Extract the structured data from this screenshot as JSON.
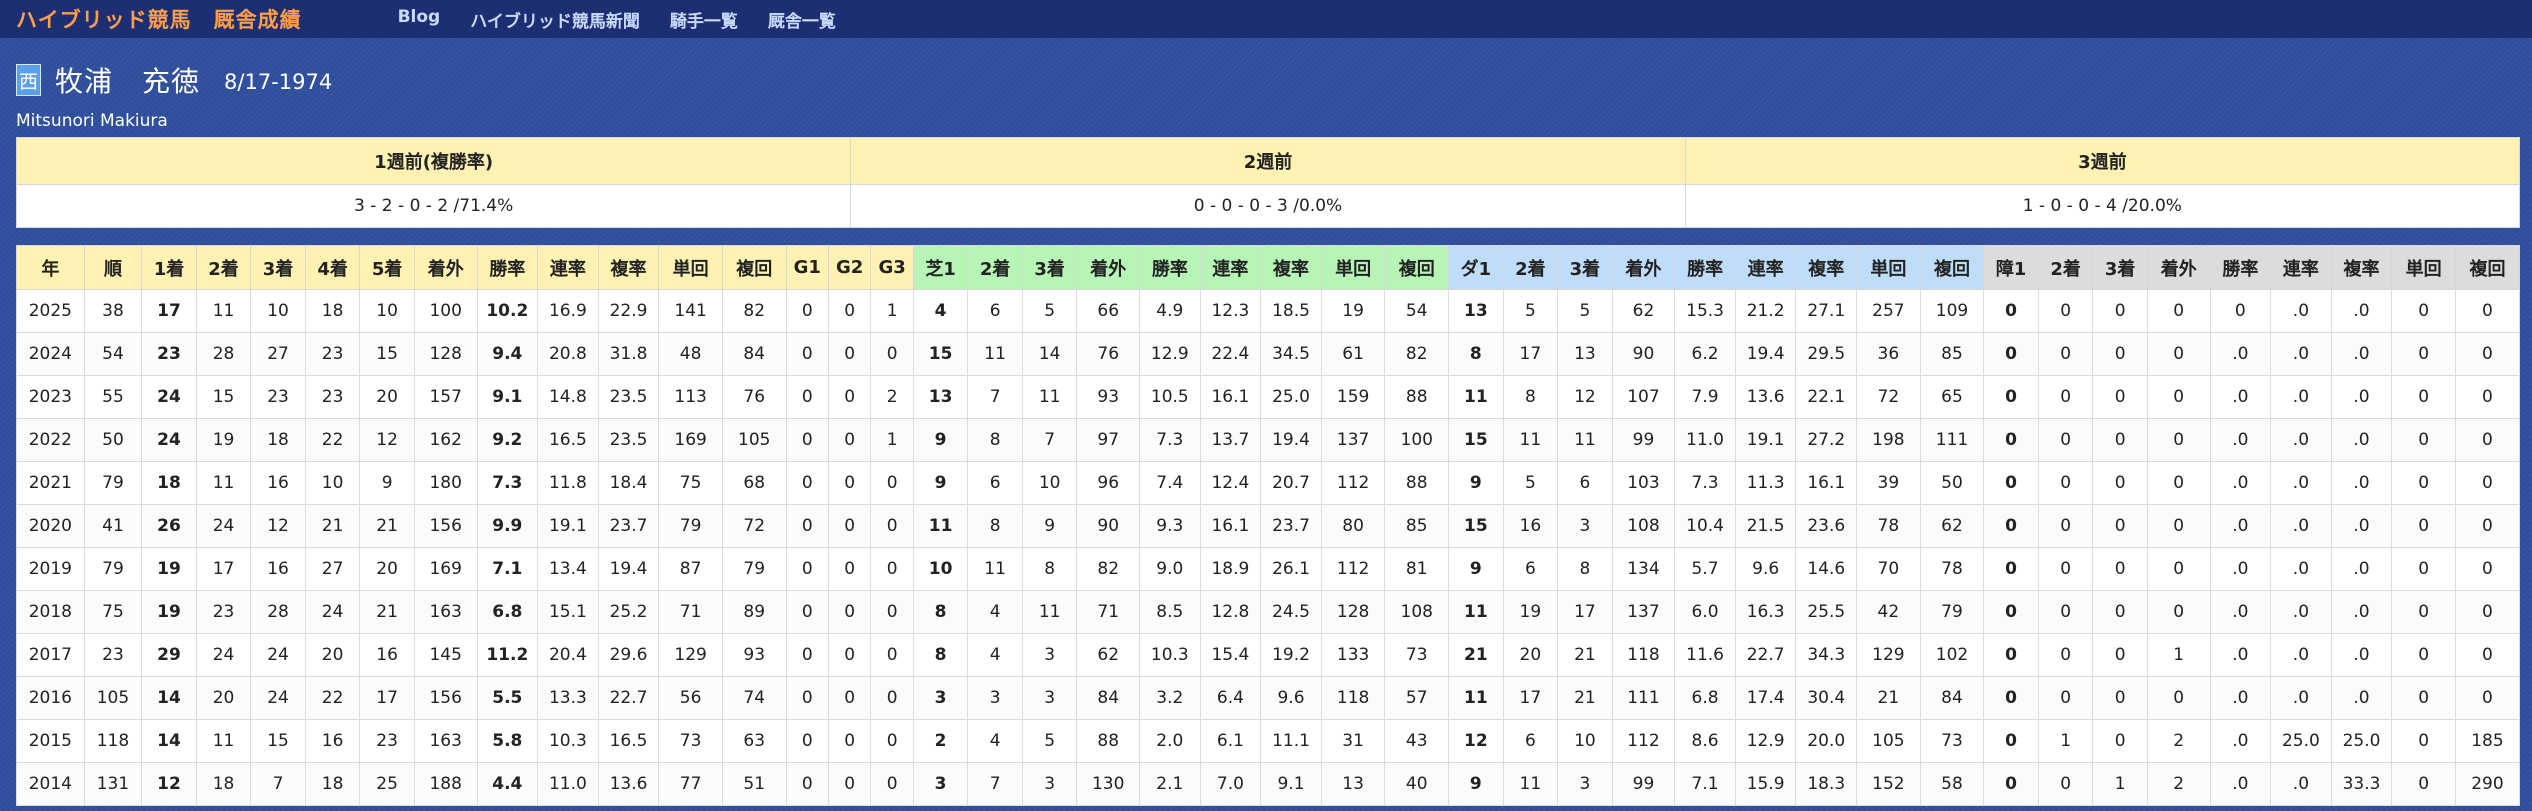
{
  "nav": {
    "brand": "ハイブリッド競馬",
    "section": "厩舎成績",
    "links": [
      "Blog",
      "ハイブリッド競馬新聞",
      "騎手一覧",
      "厩舎一覧"
    ]
  },
  "jockey": {
    "region_badge": "西",
    "name": "牧浦　充徳",
    "birthdate": "8/17-1974",
    "romaji": "Mitsunori Makiura"
  },
  "weeks": {
    "headers": [
      "1週前(複勝率)",
      "2週前",
      "3週前"
    ],
    "values": [
      "3 - 2 - 0 - 2 /71.4%",
      "0 - 0 - 0 - 3 /0.0%",
      "1 - 0 - 0 - 4 /20.0%"
    ]
  },
  "stats": {
    "headers": [
      "年",
      "順",
      "1着",
      "2着",
      "3着",
      "4着",
      "5着",
      "着外",
      "勝率",
      "連率",
      "複率",
      "単回",
      "複回",
      "G1",
      "G2",
      "G3",
      "芝1",
      "2着",
      "3着",
      "着外",
      "勝率",
      "連率",
      "複率",
      "単回",
      "複回",
      "ダ1",
      "2着",
      "3着",
      "着外",
      "勝率",
      "連率",
      "複率",
      "単回",
      "複回",
      "障1",
      "2着",
      "3着",
      "着外",
      "勝率",
      "連率",
      "複率",
      "単回",
      "複回"
    ],
    "header_groups": [
      "main",
      "main",
      "main",
      "main",
      "main",
      "main",
      "main",
      "main",
      "main",
      "main",
      "main",
      "main",
      "main",
      "main",
      "main",
      "main",
      "turf",
      "turf",
      "turf",
      "turf",
      "turf",
      "turf",
      "turf",
      "turf",
      "turf",
      "dirt",
      "dirt",
      "dirt",
      "dirt",
      "dirt",
      "dirt",
      "dirt",
      "dirt",
      "dirt",
      "steep",
      "steep",
      "steep",
      "steep",
      "steep",
      "steep",
      "steep",
      "steep",
      "steep"
    ],
    "bold_columns": [
      2,
      8,
      16,
      25,
      34
    ],
    "group_colors": {
      "main": "#fff2b3",
      "turf": "#b7f5b7",
      "dirt": "#bfdcf8",
      "steep": "#dcdcdc"
    },
    "rows": [
      [
        "2025",
        "38",
        "17",
        "11",
        "10",
        "18",
        "10",
        "100",
        "10.2",
        "16.9",
        "22.9",
        "141",
        "82",
        "0",
        "0",
        "1",
        "4",
        "6",
        "5",
        "66",
        "4.9",
        "12.3",
        "18.5",
        "19",
        "54",
        "13",
        "5",
        "5",
        "62",
        "15.3",
        "21.2",
        "27.1",
        "257",
        "109",
        "0",
        "0",
        "0",
        "0",
        "0",
        ".0",
        ".0",
        "0",
        "0"
      ],
      [
        "2024",
        "54",
        "23",
        "28",
        "27",
        "23",
        "15",
        "128",
        "9.4",
        "20.8",
        "31.8",
        "48",
        "84",
        "0",
        "0",
        "0",
        "15",
        "11",
        "14",
        "76",
        "12.9",
        "22.4",
        "34.5",
        "61",
        "82",
        "8",
        "17",
        "13",
        "90",
        "6.2",
        "19.4",
        "29.5",
        "36",
        "85",
        "0",
        "0",
        "0",
        "0",
        ".0",
        ".0",
        ".0",
        "0",
        "0"
      ],
      [
        "2023",
        "55",
        "24",
        "15",
        "23",
        "23",
        "20",
        "157",
        "9.1",
        "14.8",
        "23.5",
        "113",
        "76",
        "0",
        "0",
        "2",
        "13",
        "7",
        "11",
        "93",
        "10.5",
        "16.1",
        "25.0",
        "159",
        "88",
        "11",
        "8",
        "12",
        "107",
        "7.9",
        "13.6",
        "22.1",
        "72",
        "65",
        "0",
        "0",
        "0",
        "0",
        ".0",
        ".0",
        ".0",
        "0",
        "0"
      ],
      [
        "2022",
        "50",
        "24",
        "19",
        "18",
        "22",
        "12",
        "162",
        "9.2",
        "16.5",
        "23.5",
        "169",
        "105",
        "0",
        "0",
        "1",
        "9",
        "8",
        "7",
        "97",
        "7.3",
        "13.7",
        "19.4",
        "137",
        "100",
        "15",
        "11",
        "11",
        "99",
        "11.0",
        "19.1",
        "27.2",
        "198",
        "111",
        "0",
        "0",
        "0",
        "0",
        ".0",
        ".0",
        ".0",
        "0",
        "0"
      ],
      [
        "2021",
        "79",
        "18",
        "11",
        "16",
        "10",
        "9",
        "180",
        "7.3",
        "11.8",
        "18.4",
        "75",
        "68",
        "0",
        "0",
        "0",
        "9",
        "6",
        "10",
        "96",
        "7.4",
        "12.4",
        "20.7",
        "112",
        "88",
        "9",
        "5",
        "6",
        "103",
        "7.3",
        "11.3",
        "16.1",
        "39",
        "50",
        "0",
        "0",
        "0",
        "0",
        ".0",
        ".0",
        ".0",
        "0",
        "0"
      ],
      [
        "2020",
        "41",
        "26",
        "24",
        "12",
        "21",
        "21",
        "156",
        "9.9",
        "19.1",
        "23.7",
        "79",
        "72",
        "0",
        "0",
        "0",
        "11",
        "8",
        "9",
        "90",
        "9.3",
        "16.1",
        "23.7",
        "80",
        "85",
        "15",
        "16",
        "3",
        "108",
        "10.4",
        "21.5",
        "23.6",
        "78",
        "62",
        "0",
        "0",
        "0",
        "0",
        ".0",
        ".0",
        ".0",
        "0",
        "0"
      ],
      [
        "2019",
        "79",
        "19",
        "17",
        "16",
        "27",
        "20",
        "169",
        "7.1",
        "13.4",
        "19.4",
        "87",
        "79",
        "0",
        "0",
        "0",
        "10",
        "11",
        "8",
        "82",
        "9.0",
        "18.9",
        "26.1",
        "112",
        "81",
        "9",
        "6",
        "8",
        "134",
        "5.7",
        "9.6",
        "14.6",
        "70",
        "78",
        "0",
        "0",
        "0",
        "0",
        ".0",
        ".0",
        ".0",
        "0",
        "0"
      ],
      [
        "2018",
        "75",
        "19",
        "23",
        "28",
        "24",
        "21",
        "163",
        "6.8",
        "15.1",
        "25.2",
        "71",
        "89",
        "0",
        "0",
        "0",
        "8",
        "4",
        "11",
        "71",
        "8.5",
        "12.8",
        "24.5",
        "128",
        "108",
        "11",
        "19",
        "17",
        "137",
        "6.0",
        "16.3",
        "25.5",
        "42",
        "79",
        "0",
        "0",
        "0",
        "0",
        ".0",
        ".0",
        ".0",
        "0",
        "0"
      ],
      [
        "2017",
        "23",
        "29",
        "24",
        "24",
        "20",
        "16",
        "145",
        "11.2",
        "20.4",
        "29.6",
        "129",
        "93",
        "0",
        "0",
        "0",
        "8",
        "4",
        "3",
        "62",
        "10.3",
        "15.4",
        "19.2",
        "133",
        "73",
        "21",
        "20",
        "21",
        "118",
        "11.6",
        "22.7",
        "34.3",
        "129",
        "102",
        "0",
        "0",
        "0",
        "1",
        ".0",
        ".0",
        ".0",
        "0",
        "0"
      ],
      [
        "2016",
        "105",
        "14",
        "20",
        "24",
        "22",
        "17",
        "156",
        "5.5",
        "13.3",
        "22.7",
        "56",
        "74",
        "0",
        "0",
        "0",
        "3",
        "3",
        "3",
        "84",
        "3.2",
        "6.4",
        "9.6",
        "118",
        "57",
        "11",
        "17",
        "21",
        "111",
        "6.8",
        "17.4",
        "30.4",
        "21",
        "84",
        "0",
        "0",
        "0",
        "0",
        ".0",
        ".0",
        ".0",
        "0",
        "0"
      ],
      [
        "2015",
        "118",
        "14",
        "11",
        "15",
        "16",
        "23",
        "163",
        "5.8",
        "10.3",
        "16.5",
        "73",
        "63",
        "0",
        "0",
        "0",
        "2",
        "4",
        "5",
        "88",
        "2.0",
        "6.1",
        "11.1",
        "31",
        "43",
        "12",
        "6",
        "10",
        "112",
        "8.6",
        "12.9",
        "20.0",
        "105",
        "73",
        "0",
        "1",
        "0",
        "2",
        ".0",
        "25.0",
        "25.0",
        "0",
        "185"
      ],
      [
        "2014",
        "131",
        "12",
        "18",
        "7",
        "18",
        "25",
        "188",
        "4.4",
        "11.0",
        "13.6",
        "77",
        "51",
        "0",
        "0",
        "0",
        "3",
        "7",
        "3",
        "130",
        "2.1",
        "7.0",
        "9.1",
        "13",
        "40",
        "9",
        "11",
        "3",
        "99",
        "7.1",
        "15.9",
        "18.3",
        "152",
        "58",
        "0",
        "0",
        "1",
        "2",
        ".0",
        ".0",
        "33.3",
        "0",
        "290"
      ]
    ]
  }
}
